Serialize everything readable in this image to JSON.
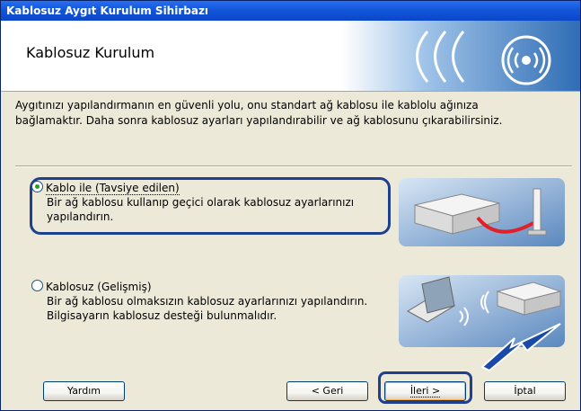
{
  "window": {
    "title": "Kablosuz Aygıt Kurulum Sihirbazı"
  },
  "header": {
    "title": "Kablosuz Kurulum"
  },
  "intro": {
    "line1": "Aygıtınızı yapılandırmanın en güvenli yolu, onu standart ağ kablosu ile kablolu ağınıza",
    "line2": "bağlamaktır. Daha sonra kablosuz ayarları yapılandırabilir ve ağ kablosunu çıkarabilirsiniz."
  },
  "options": [
    {
      "label": "Kablo ile (Tavsiye edilen)",
      "desc1": "Bir ağ kablosu kullanıp geçici olarak kablosuz ayarlarınızı",
      "desc2": "yapılandırın.",
      "selected": true
    },
    {
      "label": "Kablosuz (Gelişmiş)",
      "desc1": "Bir ağ kablosu olmaksızın kablosuz ayarlarınızı yapılandırın.",
      "desc2": "Bilgisayarın kablosuz desteği bulunmalıdır.",
      "selected": false
    }
  ],
  "buttons": {
    "help": "Yardım",
    "back": "< Geri",
    "next": "İleri >",
    "cancel": "İptal"
  },
  "colors": {
    "titlebar": "#0a46c8",
    "highlight": "#1f3f8f",
    "cable": "#e0202a"
  }
}
